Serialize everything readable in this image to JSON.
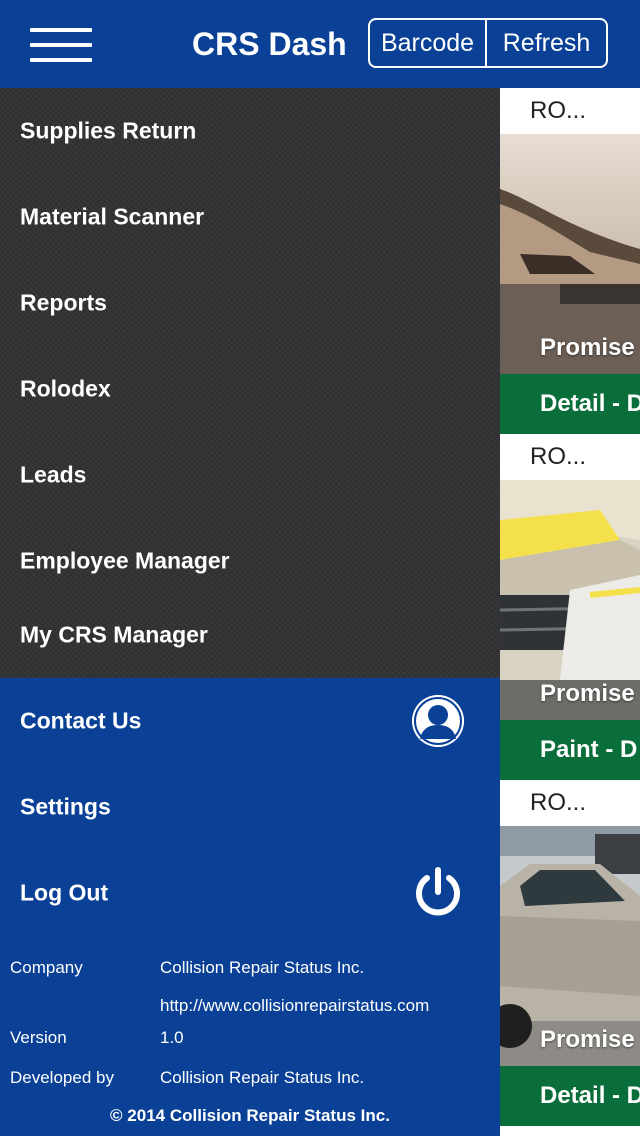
{
  "header": {
    "title": "CRS Dash",
    "barcode_label": "Barcode",
    "refresh_label": "Refresh"
  },
  "menu": {
    "items": [
      {
        "label": "Supplies Return"
      },
      {
        "label": "Material Scanner"
      },
      {
        "label": "Reports"
      },
      {
        "label": "Rolodex"
      },
      {
        "label": "Leads"
      },
      {
        "label": "Employee Manager"
      },
      {
        "label": "My CRS Manager"
      },
      {
        "label": "Contact Us",
        "icon": "contact-person-icon"
      },
      {
        "label": "Settings"
      },
      {
        "label": "Log Out",
        "icon": "power-icon"
      }
    ]
  },
  "about": {
    "company_label": "Company",
    "company_value": "Collision Repair Status Inc.",
    "website": "http://www.collisionrepairstatus.com",
    "version_label": "Version",
    "version_value": "1.0",
    "developer_label": "Developed by",
    "developer_value": "Collision Repair Status Inc.",
    "copyright": "© 2014 Collision Repair Status Inc."
  },
  "cards": [
    {
      "ro": "RO...",
      "promise": "Promise",
      "status": "Detail - D"
    },
    {
      "ro": "RO...",
      "promise": "Promise",
      "status": "Paint - D"
    },
    {
      "ro": "RO...",
      "promise": "Promise",
      "status": "Detail - D"
    }
  ],
  "colors": {
    "header_blue": "#0a4196",
    "drawer_dark": "#333335",
    "status_green": "#0a6e3a"
  }
}
